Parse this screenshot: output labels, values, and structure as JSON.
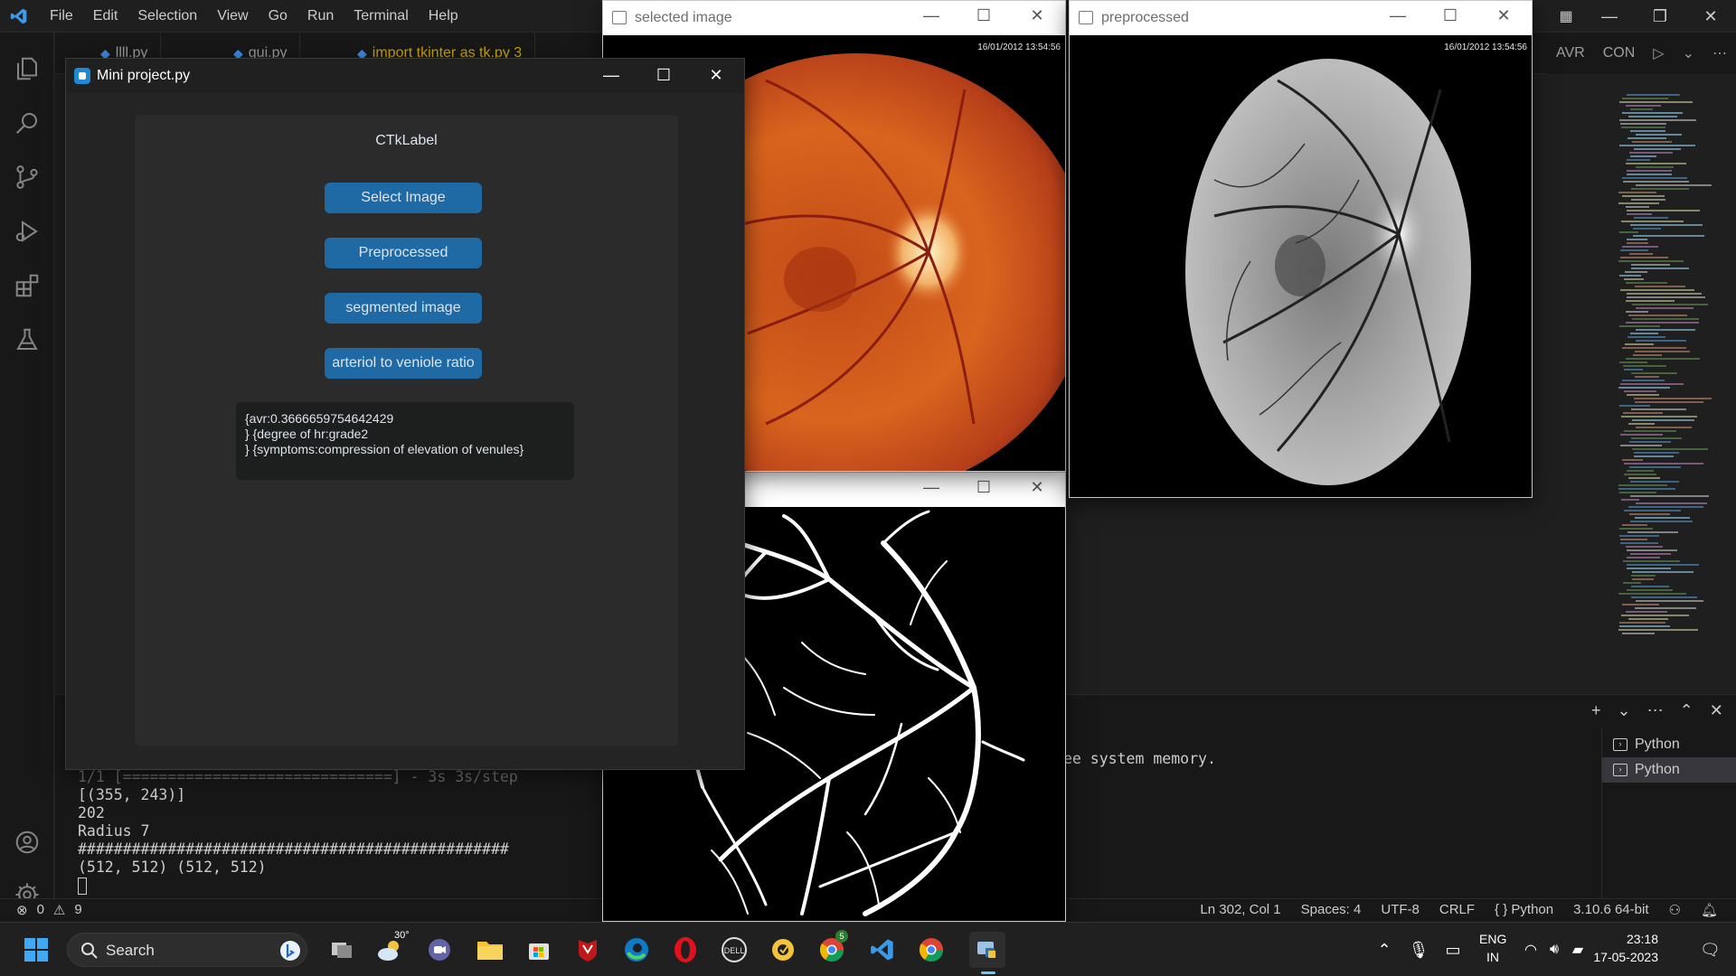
{
  "vscode": {
    "menu": [
      "File",
      "Edit",
      "Selection",
      "View",
      "Go",
      "Run",
      "Terminal",
      "Help"
    ],
    "tabs": [
      {
        "label": "llll.py",
        "state": "normal"
      },
      {
        "label": "gui.py",
        "state": "normal"
      },
      {
        "label": "import tkinter as tk.py 3",
        "state": "warning"
      }
    ],
    "tabs_right": [
      "AVR",
      "CON"
    ],
    "terminal_lines": [
      "1/1 [==============================] - 3s 3s/step",
      "[(355, 243)]",
      "202",
      "Radius 7",
      "################################################",
      "(512, 512) (512, 512)"
    ],
    "terminal_message": "ee system memory.",
    "terminal_list": [
      "Python",
      "Python"
    ],
    "status_left": {
      "errors": "0",
      "warnings": "9"
    },
    "status_right": [
      "Ln 302, Col 1",
      "Spaces: 4",
      "UTF-8",
      "CRLF",
      "Python",
      "3.10.6 64-bit"
    ]
  },
  "windows": {
    "selected": {
      "title": "selected image",
      "timestamp": "16/01/2012 13:54:56"
    },
    "preprocessed": {
      "title": "preprocessed",
      "timestamp": "16/01/2012 13:54:56"
    },
    "segmented": {
      "title": ""
    },
    "mini_project": {
      "title": "Mini project.py",
      "label": "CTkLabel",
      "buttons": [
        "Select Image",
        "Preprocessed",
        "segmented image",
        "arteriol to veniole ratio"
      ],
      "result_lines": [
        "{avr:0.3666659754642429",
        "} {degree of hr:grade2",
        "} {symptoms:compression of elevation of venules}"
      ]
    }
  },
  "taskbar": {
    "search_label": "Search",
    "weather_temp": "30°",
    "chrome_badge": "5",
    "language": [
      "ENG",
      "IN"
    ],
    "time": "23:18",
    "date": "17-05-2023"
  }
}
